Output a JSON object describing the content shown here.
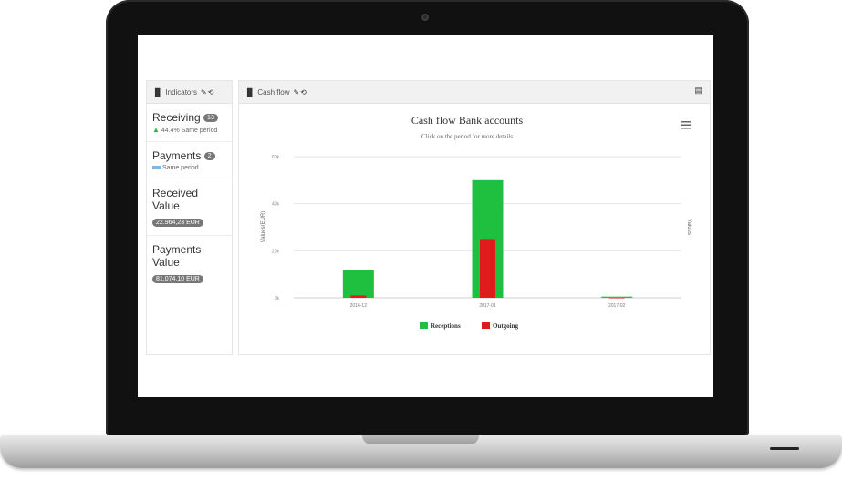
{
  "indicators": {
    "header": "Indicators",
    "receiving": {
      "label": "Receiving",
      "badge": "13",
      "trend": "44.4% Same period"
    },
    "payments": {
      "label": "Payments",
      "badge": "2",
      "trend": "Same period"
    },
    "received_value": {
      "label": "Received Value",
      "amount": "22.964,23 EUR"
    },
    "payments_value": {
      "label": "Payments Value",
      "amount": "81.074,10 EUR"
    }
  },
  "cashflow": {
    "header": "Cash flow"
  },
  "colors": {
    "receptions": "#1fbf3f",
    "outgoing": "#e01b1b"
  },
  "chart_data": {
    "type": "bar",
    "title": "Cash flow Bank accounts",
    "subtitle": "Click on the period for more details",
    "ylabel": "Values(EUR)",
    "ylabel_right": "Values",
    "categories": [
      "2016-12",
      "2017-01",
      "2017-02"
    ],
    "series": [
      {
        "name": "Receptions",
        "values": [
          12000,
          50000,
          500
        ]
      },
      {
        "name": "Outgoing",
        "values": [
          1000,
          25000,
          0
        ]
      }
    ],
    "yticks": [
      "0k",
      "20k",
      "40k",
      "60k"
    ],
    "ylim": [
      0,
      60000
    ],
    "grid": true,
    "legend": "bottom"
  }
}
